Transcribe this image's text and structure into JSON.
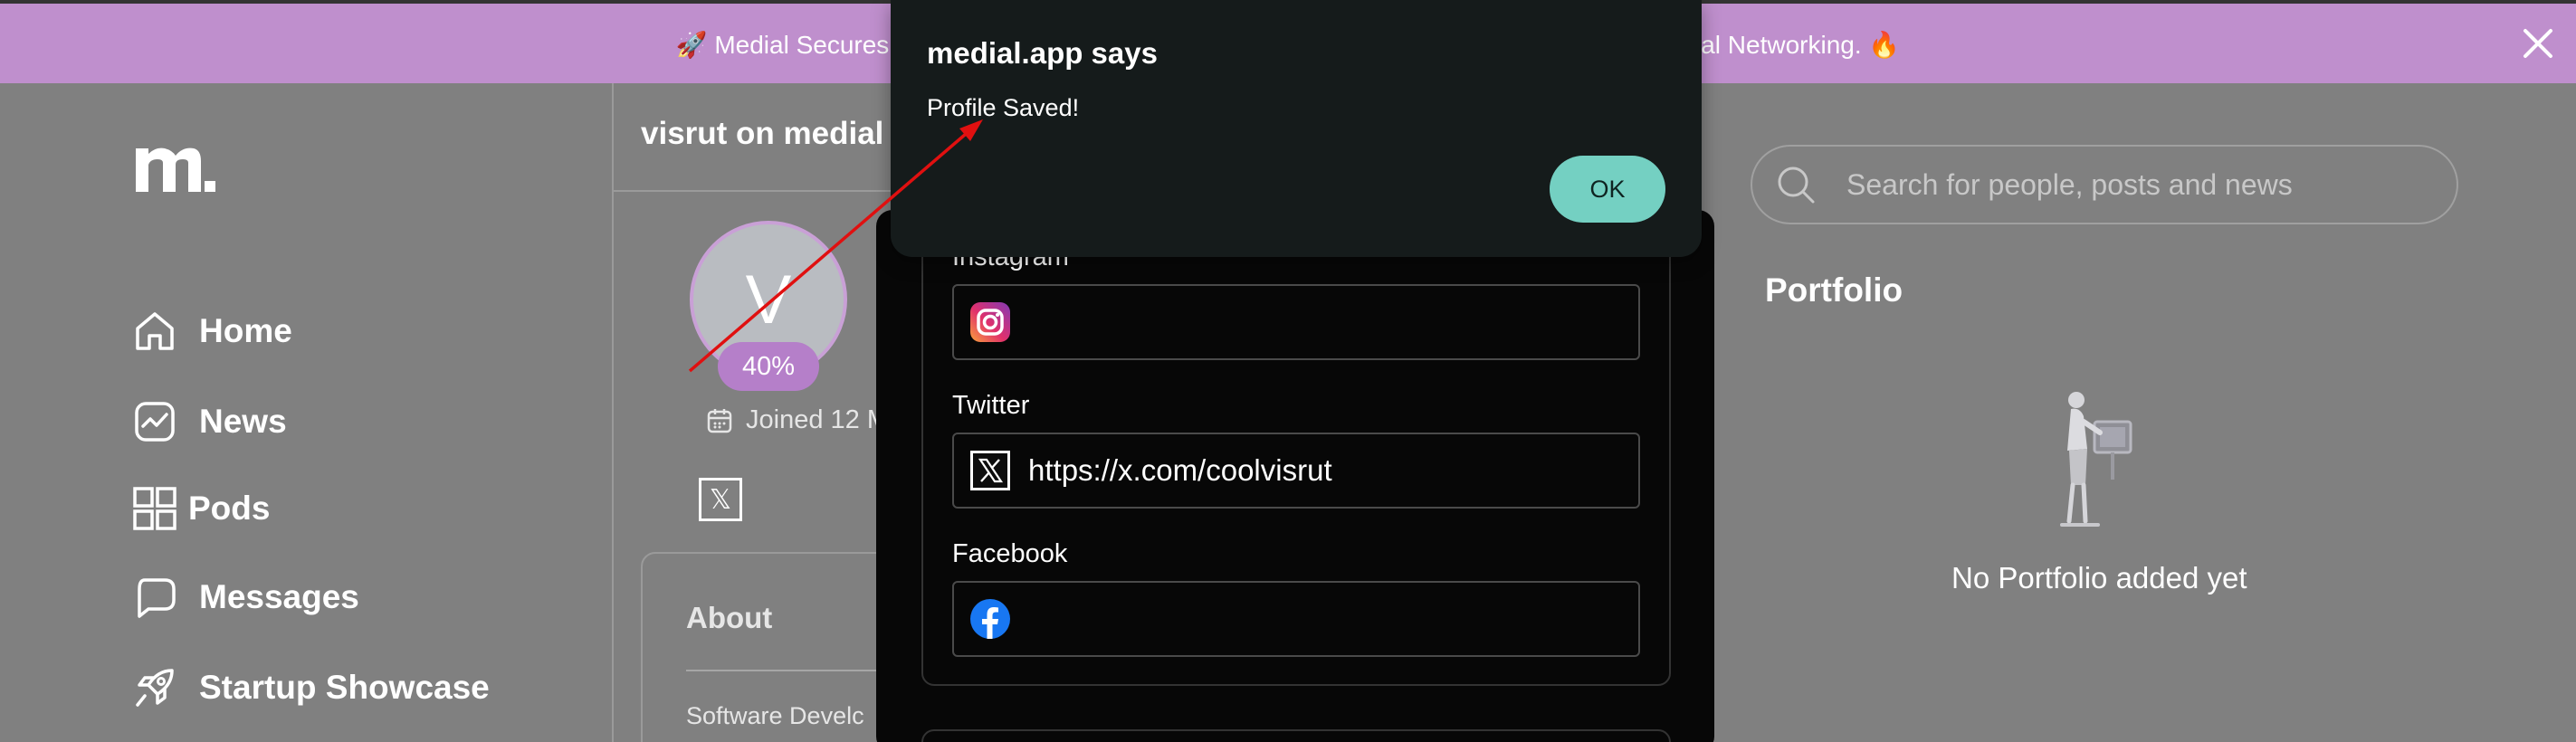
{
  "banner": {
    "text_left": "🚀 Medial Secures Inve",
    "text_right": "ial Networking. 🔥",
    "close_icon": "close-icon"
  },
  "sidebar": {
    "logo": "m.",
    "items": [
      {
        "label": "Home",
        "icon": "home-icon"
      },
      {
        "label": "News",
        "icon": "news-icon"
      },
      {
        "label": "Pods",
        "icon": "grid-icon"
      },
      {
        "label": "Messages",
        "icon": "chat-icon"
      },
      {
        "label": "Startup Showcase",
        "icon": "rocket-icon"
      }
    ]
  },
  "profile": {
    "title": "visrut on medial",
    "avatar_initial": "V",
    "completion": "40%",
    "joined": "Joined 12 M",
    "x_icon_glyph": "𝕏",
    "about_title": "About",
    "about_text": "Software Develc"
  },
  "modal": {
    "fields": [
      {
        "label": "Instagram",
        "value": "",
        "icon": "instagram-icon"
      },
      {
        "label": "Twitter",
        "value": "https://x.com/coolvisrut",
        "icon": "x-icon"
      },
      {
        "label": "Facebook",
        "value": "",
        "icon": "facebook-icon"
      }
    ]
  },
  "alert": {
    "title": "medial.app says",
    "message": "Profile Saved!",
    "ok_label": "OK"
  },
  "search": {
    "placeholder": "Search for people, posts and news"
  },
  "portfolio": {
    "title": "Portfolio",
    "empty_text": "No Portfolio added yet"
  },
  "colors": {
    "page_bg": "#808080",
    "banner": "#bf8fcd",
    "accent_purple": "#b57fc9",
    "modal_bg": "#070707",
    "alert_bg": "#151b1b",
    "ok_button": "#74d0c2",
    "annotation_arrow": "#e01010"
  }
}
